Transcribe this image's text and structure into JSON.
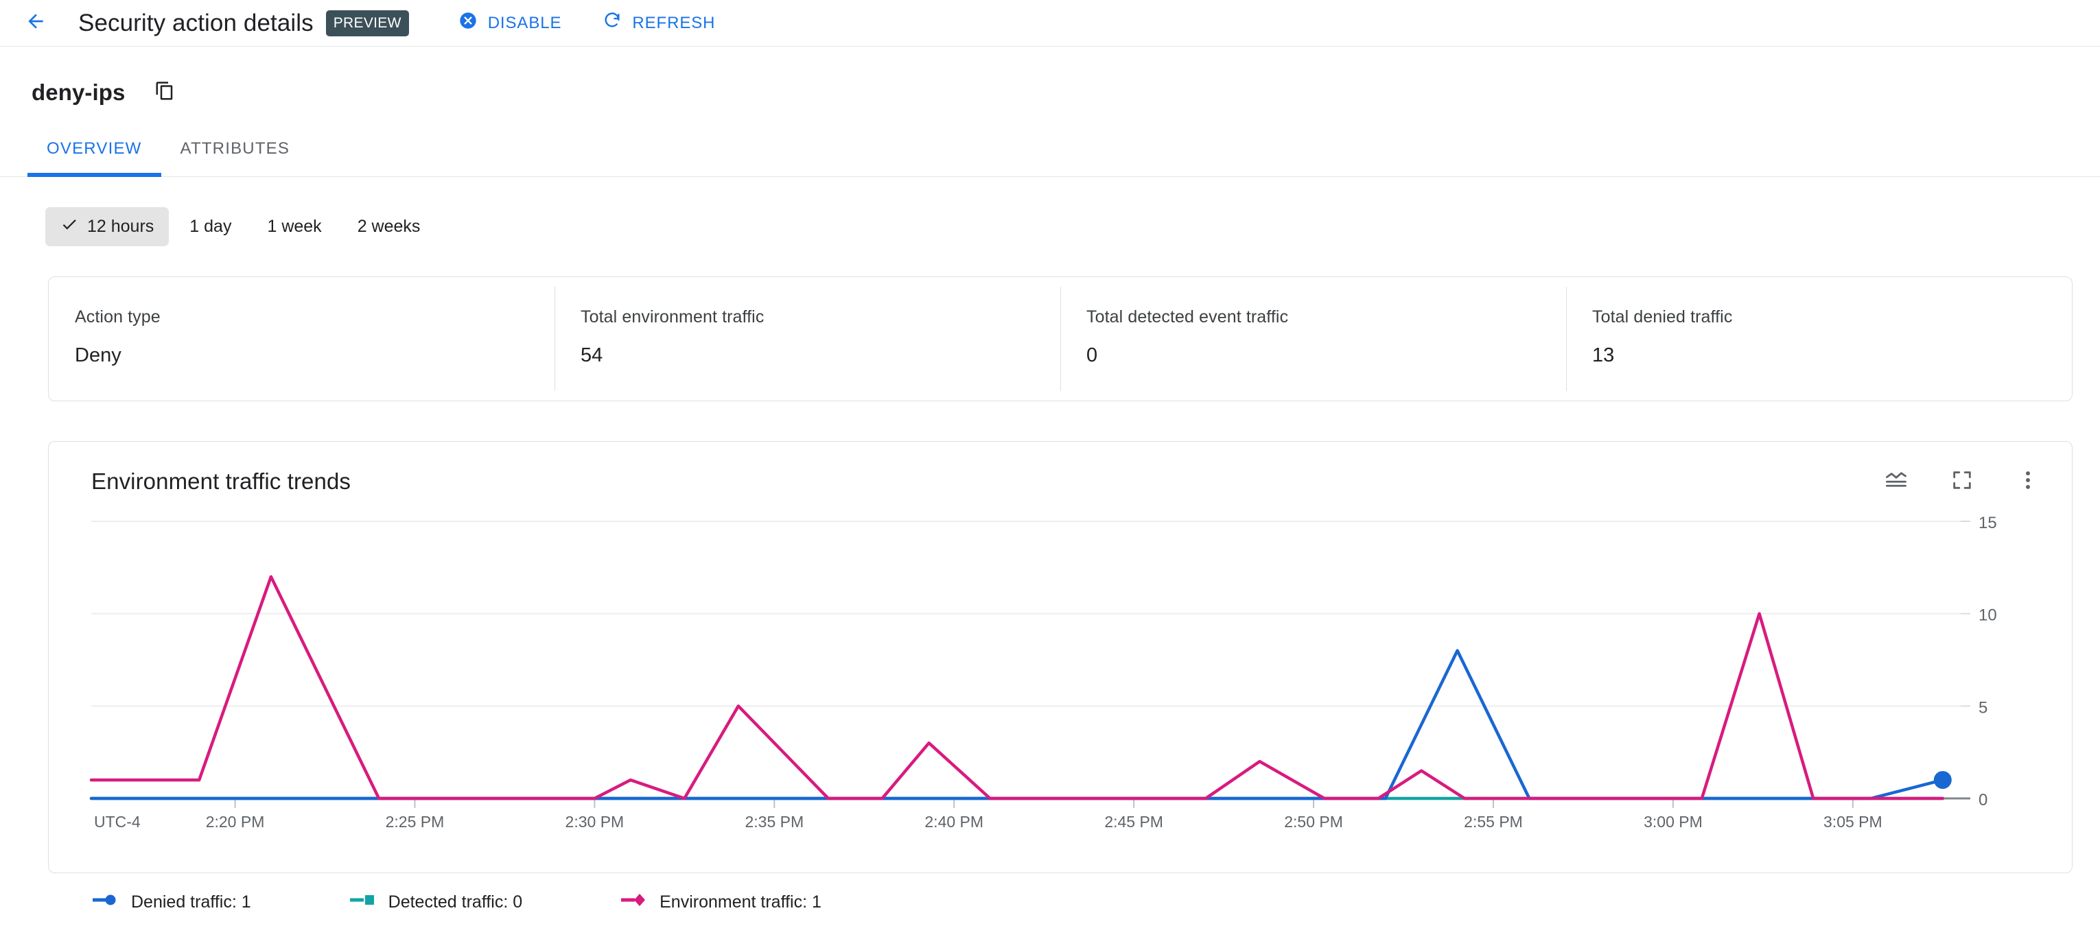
{
  "appbar": {
    "back_icon": "arrow-back-icon",
    "title": "Security action details",
    "preview_badge": "PREVIEW",
    "actions": [
      {
        "label": "DISABLE",
        "icon": "cancel-circle-icon"
      },
      {
        "label": "REFRESH",
        "icon": "refresh-icon"
      }
    ]
  },
  "resource": {
    "name": "deny-ips",
    "copy_icon": "copy-icon"
  },
  "tabs": [
    {
      "label": "OVERVIEW",
      "active": true
    },
    {
      "label": "ATTRIBUTES",
      "active": false
    }
  ],
  "time_ranges": {
    "check_icon": "check-icon",
    "options": [
      {
        "label": "12 hours",
        "selected": true
      },
      {
        "label": "1 day",
        "selected": false
      },
      {
        "label": "1 week",
        "selected": false
      },
      {
        "label": "2 weeks",
        "selected": false
      }
    ]
  },
  "stats": [
    {
      "label": "Action type",
      "value": "Deny"
    },
    {
      "label": "Total environment traffic",
      "value": "54"
    },
    {
      "label": "Total detected event traffic",
      "value": "0"
    },
    {
      "label": "Total denied traffic",
      "value": "13"
    }
  ],
  "chart_card": {
    "title": "Environment traffic trends",
    "tools": [
      {
        "name": "chart-type-icon"
      },
      {
        "name": "fullscreen-icon"
      },
      {
        "name": "more-vert-icon"
      }
    ]
  },
  "colors": {
    "accent_blue": "#1a73e8",
    "denied_traffic": "#1967d2",
    "detected_traffic": "#12a4a4",
    "environment_traffic": "#d81b7e",
    "grid": "#eeeeee",
    "axis": "#80868b",
    "preview_badge_bg": "#3c5059"
  },
  "chart_data": {
    "type": "line",
    "title": "Environment traffic trends",
    "xlabel": "",
    "ylabel": "",
    "timezone_label": "UTC-4",
    "x_tick_labels": [
      "2:20 PM",
      "2:25 PM",
      "2:30 PM",
      "2:35 PM",
      "2:40 PM",
      "2:45 PM",
      "2:50 PM",
      "2:55 PM",
      "3:00 PM",
      "3:05 PM"
    ],
    "x_tick_minutes": [
      140,
      145,
      150,
      155,
      160,
      165,
      170,
      175,
      180,
      185
    ],
    "x_range_minutes": [
      136,
      188
    ],
    "y_ticks": [
      0,
      5,
      10,
      15
    ],
    "ylim": [
      0,
      15
    ],
    "grid": true,
    "legend_position": "bottom-left",
    "series": [
      {
        "name": "Denied traffic",
        "legend_label": "Denied traffic: 1",
        "color": "#1967d2",
        "marker": "circle",
        "points": [
          {
            "t": 136,
            "v": 0
          },
          {
            "t": 170.5,
            "v": 0
          },
          {
            "t": 171.5,
            "v": 0
          },
          {
            "t": 172.0,
            "v": 0
          },
          {
            "t": 174.0,
            "v": 8
          },
          {
            "t": 176.0,
            "v": 0
          },
          {
            "t": 182.0,
            "v": 0
          },
          {
            "t": 185.5,
            "v": 0
          },
          {
            "t": 187.5,
            "v": 1
          }
        ],
        "end_marker": {
          "t": 187.5,
          "v": 1
        }
      },
      {
        "name": "Detected traffic",
        "legend_label": "Detected traffic: 0",
        "color": "#12a4a4",
        "marker": "square",
        "points": [
          {
            "t": 136,
            "v": 0
          },
          {
            "t": 187.5,
            "v": 0
          }
        ]
      },
      {
        "name": "Environment traffic",
        "legend_label": "Environment traffic: 1",
        "color": "#d81b7e",
        "marker": "diamond",
        "points": [
          {
            "t": 136.0,
            "v": 1
          },
          {
            "t": 139.0,
            "v": 1
          },
          {
            "t": 141.0,
            "v": 12
          },
          {
            "t": 144.0,
            "v": 0
          },
          {
            "t": 150.0,
            "v": 0
          },
          {
            "t": 151.0,
            "v": 1
          },
          {
            "t": 152.5,
            "v": 0
          },
          {
            "t": 154.0,
            "v": 5
          },
          {
            "t": 156.5,
            "v": 0
          },
          {
            "t": 158.0,
            "v": 0
          },
          {
            "t": 159.3,
            "v": 3
          },
          {
            "t": 161.0,
            "v": 0
          },
          {
            "t": 167.0,
            "v": 0
          },
          {
            "t": 168.5,
            "v": 2
          },
          {
            "t": 170.3,
            "v": 0
          },
          {
            "t": 171.8,
            "v": 0
          },
          {
            "t": 173.0,
            "v": 1.5
          },
          {
            "t": 174.2,
            "v": 0
          },
          {
            "t": 180.8,
            "v": 0
          },
          {
            "t": 182.4,
            "v": 10
          },
          {
            "t": 183.9,
            "v": 0
          },
          {
            "t": 187.5,
            "v": 0
          }
        ]
      }
    ]
  }
}
